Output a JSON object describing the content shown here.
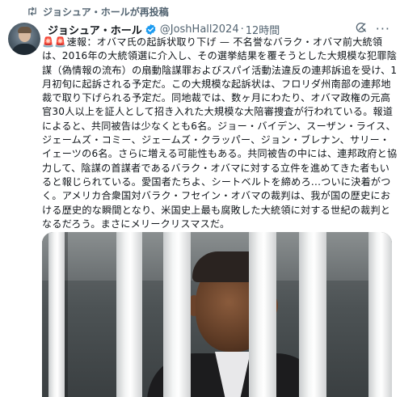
{
  "repost": {
    "label": "ジョシュア・ホールが再投稿",
    "icon": "repost-icon"
  },
  "author": {
    "name": "ジョシュア・ホール",
    "handle": "@JoshHall2024",
    "separator": "·",
    "time": "12時間",
    "verified_icon": "verified-badge-icon"
  },
  "header_icons": {
    "grok": "grok-icon",
    "more": "more-icon",
    "more_glyph": "···"
  },
  "tweet": {
    "emoji": "🚨🚨",
    "text": "速報：オバマ氏の起訴状取り下げ — 不名誉なバラク・オバマ前大統領は、2016年の大統領選に介入し、その選挙結果を覆そうとした大規模な犯罪陰謀（偽情報の流布）の扇動陰謀罪およびスパイ活動法違反の連邦訴追を受け、1月初旬に起訴される予定だ。この大規模な起訴状は、フロリダ州南部の連邦地裁で取り下げられる予定だ。同地裁では、数ヶ月にわたり、オバマ政権の元高官30人以上を証人として招き入れた大規模な大陪審捜査が行われている。報道によると、共同被告は少なくとも6名。ジョー・バイデン、スーザン・ライス、ジェームズ・コミー、ジェームズ・クラッパー、ジョン・ブレナン、サリー・イェーツの6名。さらに増える可能性もある。共同被告の中には、連邦政府と協力して、陰謀の首謀者であるバラク・オバマに対する立件を進めてきた者もいると報じられている。愛国者たちよ、シートベルトを締めろ...ついに決着がつく。アメリカ合衆国対バラク・フセイン・オバマの裁判は、我が国の歴史における歴史的な瞬間となり、米国史上最も腐敗した大統領に対する世紀の裁判となるだろう。まさにメリークリスマスだ。"
  },
  "media": {
    "alt": ""
  },
  "colors": {
    "text": "#0f1419",
    "muted": "#536471",
    "verified": "#1d9bf0"
  }
}
